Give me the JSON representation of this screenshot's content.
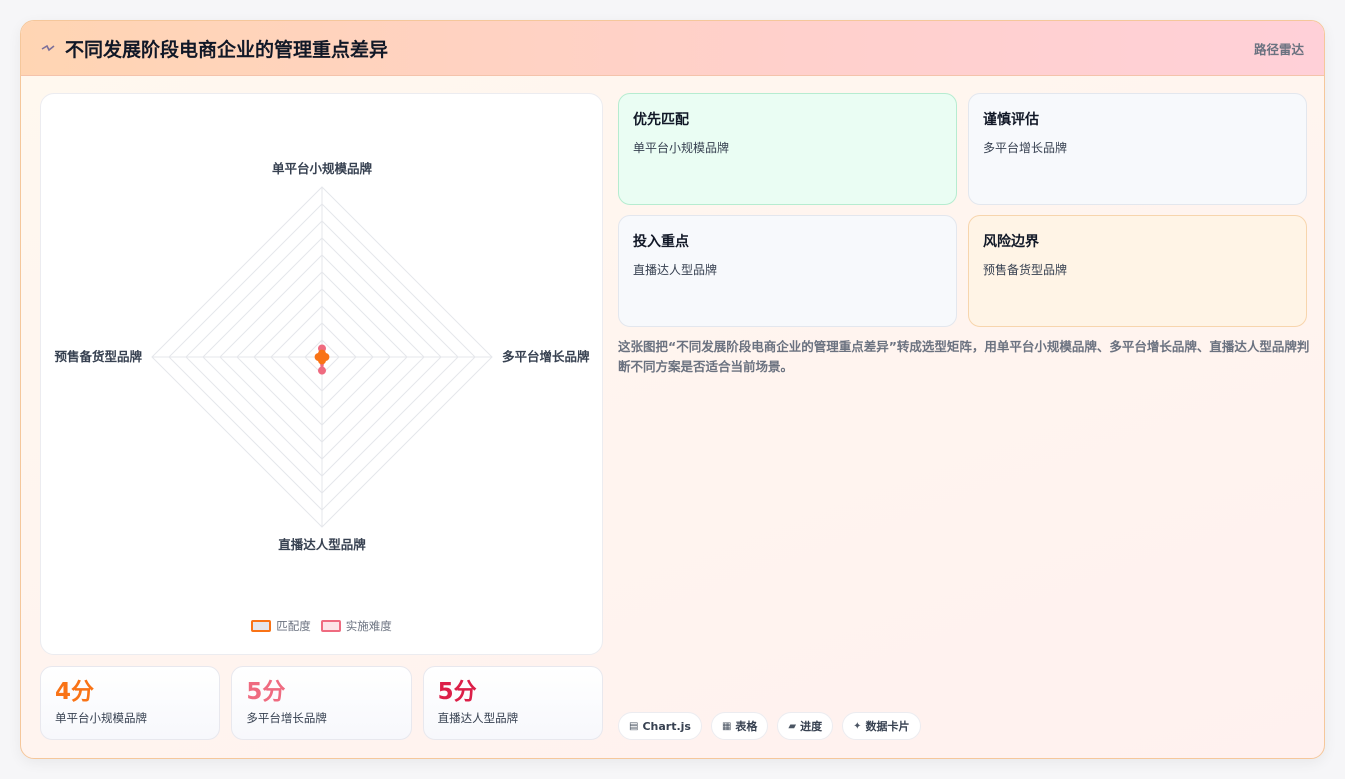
{
  "header": {
    "icon": "sparkle-icon",
    "title": "不同发展阶段电商企业的管理重点差异",
    "tag": "路径雷达"
  },
  "chart_data": {
    "type": "radar",
    "categories": [
      "单平台小规模品牌",
      "多平台增长品牌",
      "直播达人型品牌",
      "预售备货型品牌"
    ],
    "rmax": 10,
    "grid_levels": 10,
    "series": [
      {
        "name": "匹配度",
        "values": [
          0.2,
          0.2,
          0.2,
          0.2
        ],
        "color": "#f97316"
      },
      {
        "name": "实施难度",
        "values": [
          0.5,
          0.1,
          0.8,
          0.1
        ],
        "color": "#ef6b80"
      }
    ]
  },
  "stats": [
    {
      "value": "4分",
      "label": "单平台小规模品牌",
      "color": "#f97316"
    },
    {
      "value": "5分",
      "label": "多平台增长品牌",
      "color": "#ef6b80"
    },
    {
      "value": "5分",
      "label": "直播达人型品牌",
      "color": "#dc1f48"
    }
  ],
  "boxes": [
    {
      "title": "优先匹配",
      "sub": "单平台小规模品牌"
    },
    {
      "title": "谨慎评估",
      "sub": "多平台增长品牌"
    },
    {
      "title": "投入重点",
      "sub": "直播达人型品牌"
    },
    {
      "title": "风险边界",
      "sub": "预售备货型品牌"
    }
  ],
  "description": "这张图把“不同发展阶段电商企业的管理重点差异”转成选型矩阵，用单平台小规模品牌、多平台增长品牌、直播达人型品牌判断不同方案是否适合当前场景。",
  "chips": [
    {
      "icon": "chart-icon",
      "label": "Chart.js"
    },
    {
      "icon": "table-icon",
      "label": "表格"
    },
    {
      "icon": "progress-icon",
      "label": "进度"
    },
    {
      "icon": "card-icon",
      "label": "数据卡片"
    }
  ]
}
